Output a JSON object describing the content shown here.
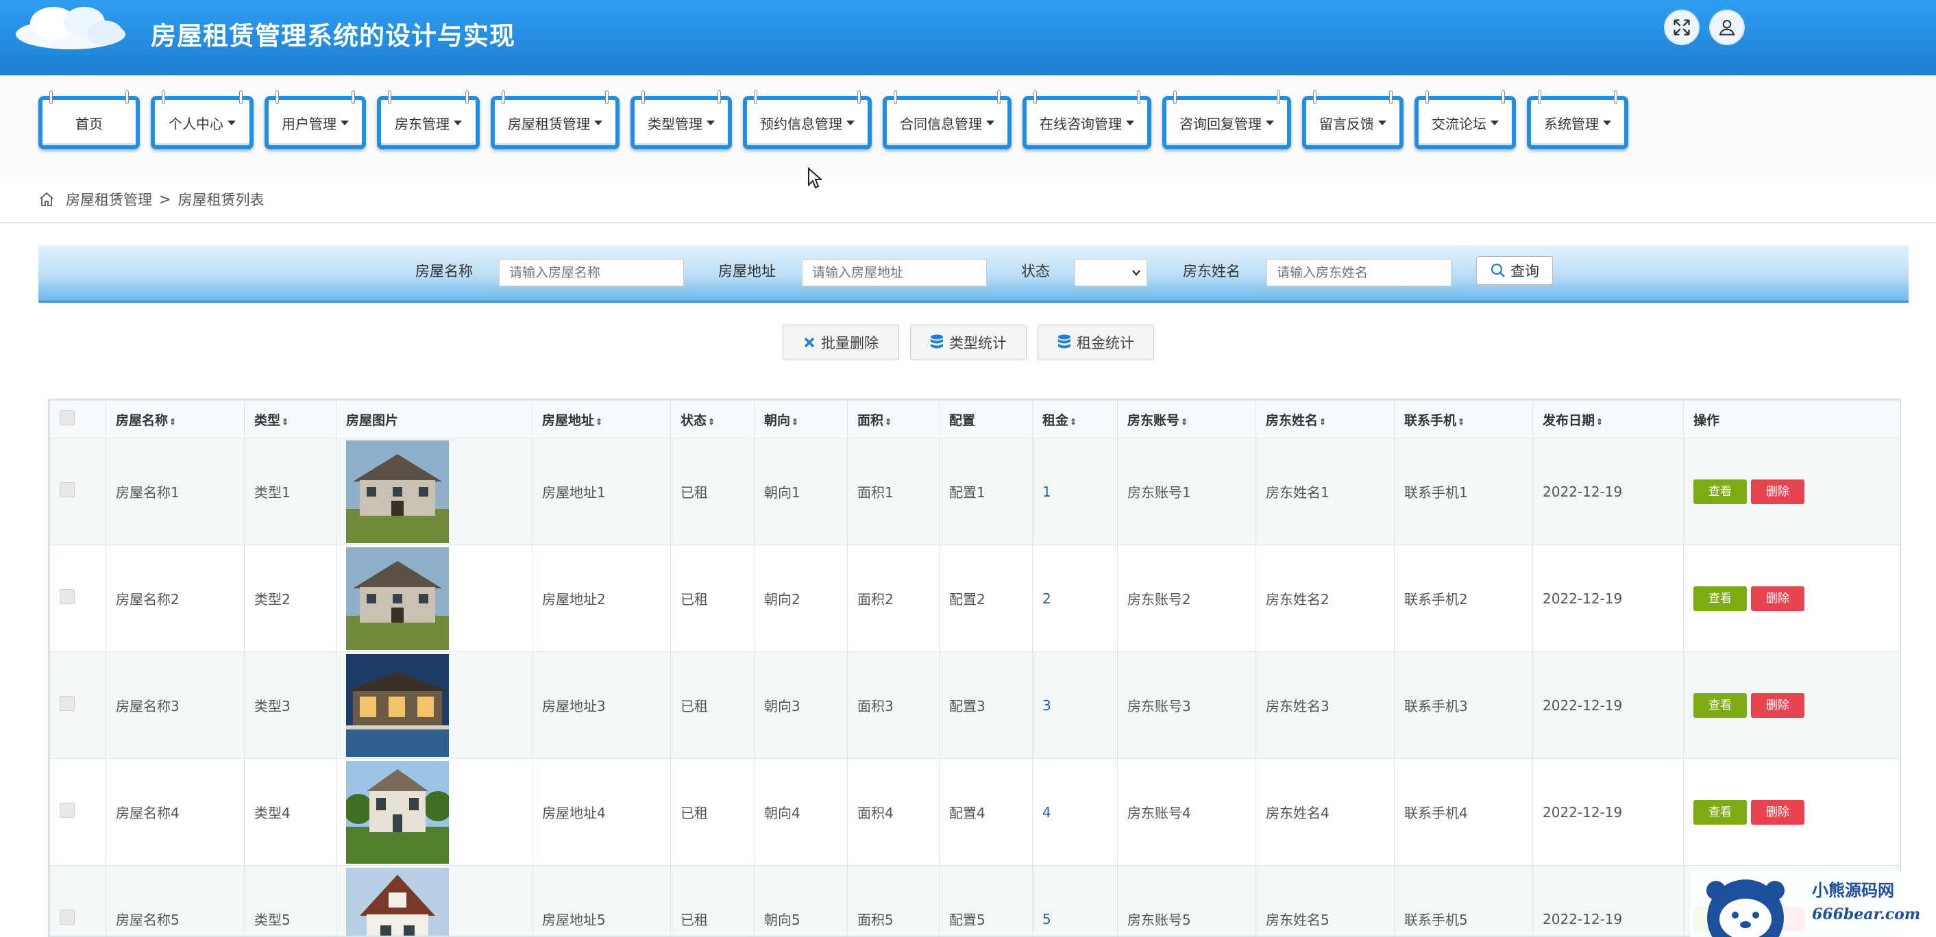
{
  "header": {
    "title": "房屋租赁管理系统的设计与实现",
    "fullscreen_icon": "expand-icon",
    "user_icon": "user-icon"
  },
  "nav": {
    "items": [
      {
        "label": "首页",
        "has_caret": false
      },
      {
        "label": "个人中心",
        "has_caret": true
      },
      {
        "label": "用户管理",
        "has_caret": true
      },
      {
        "label": "房东管理",
        "has_caret": true
      },
      {
        "label": "房屋租赁管理",
        "has_caret": true
      },
      {
        "label": "类型管理",
        "has_caret": true
      },
      {
        "label": "预约信息管理",
        "has_caret": true
      },
      {
        "label": "合同信息管理",
        "has_caret": true
      },
      {
        "label": "在线咨询管理",
        "has_caret": true
      },
      {
        "label": "咨询回复管理",
        "has_caret": true
      },
      {
        "label": "留言反馈",
        "has_caret": true
      },
      {
        "label": "交流论坛",
        "has_caret": true
      },
      {
        "label": "系统管理",
        "has_caret": true
      }
    ]
  },
  "breadcrumb": {
    "section": "房屋租赁管理",
    "separator": ">",
    "page": "房屋租赁列表"
  },
  "search": {
    "name_label": "房屋名称",
    "name_placeholder": "请输入房屋名称",
    "address_label": "房屋地址",
    "address_placeholder": "请输入房屋地址",
    "status_label": "状态",
    "status_value": "",
    "landlord_label": "房东姓名",
    "landlord_placeholder": "请输入房东姓名",
    "query_label": "查询"
  },
  "actions": {
    "batch_delete": "批量删除",
    "type_stats": "类型统计",
    "rent_stats": "租金统计"
  },
  "table": {
    "columns": [
      "房屋名称",
      "类型",
      "房屋图片",
      "房屋地址",
      "状态",
      "朝向",
      "面积",
      "配置",
      "租金",
      "房东账号",
      "房东姓名",
      "联系手机",
      "发布日期",
      "操作"
    ],
    "sortable": [
      true,
      true,
      false,
      true,
      true,
      true,
      true,
      false,
      true,
      true,
      true,
      true,
      true,
      false
    ],
    "view_label": "查看",
    "delete_label": "删除",
    "rows": [
      {
        "name": "房屋名称1",
        "type": "类型1",
        "address": "房屋地址1",
        "status": "已租",
        "orientation": "朝向1",
        "area": "面积1",
        "config": "配置1",
        "rent": "1",
        "account": "房东账号1",
        "landlord": "房东姓名1",
        "phone": "联系手机1",
        "date": "2022-12-19",
        "image": "house-photo-1"
      },
      {
        "name": "房屋名称2",
        "type": "类型2",
        "address": "房屋地址2",
        "status": "已租",
        "orientation": "朝向2",
        "area": "面积2",
        "config": "配置2",
        "rent": "2",
        "account": "房东账号2",
        "landlord": "房东姓名2",
        "phone": "联系手机2",
        "date": "2022-12-19",
        "image": "house-photo-2"
      },
      {
        "name": "房屋名称3",
        "type": "类型3",
        "address": "房屋地址3",
        "status": "已租",
        "orientation": "朝向3",
        "area": "面积3",
        "config": "配置3",
        "rent": "3",
        "account": "房东账号3",
        "landlord": "房东姓名3",
        "phone": "联系手机3",
        "date": "2022-12-19",
        "image": "house-photo-3"
      },
      {
        "name": "房屋名称4",
        "type": "类型4",
        "address": "房屋地址4",
        "status": "已租",
        "orientation": "朝向4",
        "area": "面积4",
        "config": "配置4",
        "rent": "4",
        "account": "房东账号4",
        "landlord": "房东姓名4",
        "phone": "联系手机4",
        "date": "2022-12-19",
        "image": "house-photo-4"
      },
      {
        "name": "房屋名称5",
        "type": "类型5",
        "address": "房屋地址5",
        "status": "已租",
        "orientation": "朝向5",
        "area": "面积5",
        "config": "配置5",
        "rent": "5",
        "account": "房东账号5",
        "landlord": "房东姓名5",
        "phone": "联系手机5",
        "date": "2022-12-19",
        "image": "house-photo-5"
      }
    ]
  },
  "watermark": {
    "title": "小熊源码网",
    "url": "666bear.com"
  },
  "colors": {
    "header": "#1c7fd3",
    "view_button": "#7cab12",
    "delete_button": "#e84450",
    "nav_border": "#1f8fe6"
  }
}
